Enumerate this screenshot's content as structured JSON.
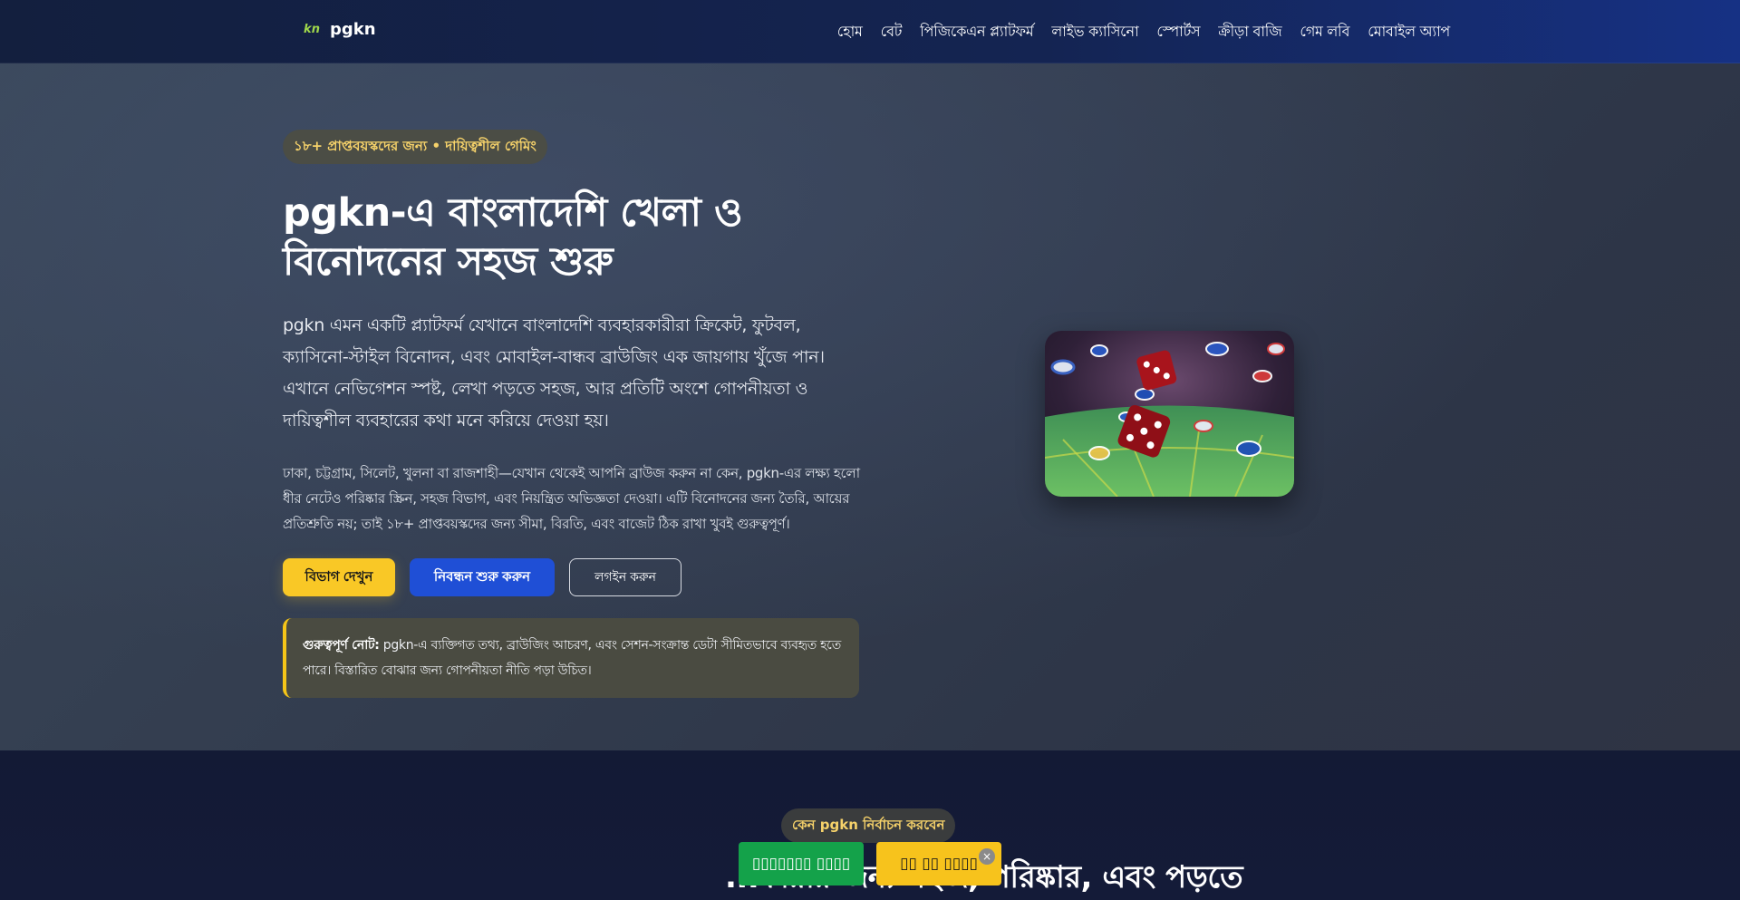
{
  "header": {
    "logo_mark": "kn",
    "brand": "pgkn",
    "nav": [
      {
        "label": "হোম"
      },
      {
        "label": "বেট"
      },
      {
        "label": "পিজিকেএন প্ল্যাটফর্ম"
      },
      {
        "label": "লাইভ ক্যাসিনো"
      },
      {
        "label": "স্পোর্টস"
      },
      {
        "label": "ক্রীড়া বাজি"
      },
      {
        "label": "গেম লবি"
      },
      {
        "label": "মোবাইল অ্যাপ"
      }
    ]
  },
  "hero": {
    "badge": "১৮+ প্রাপ্তবয়স্কদের জন্য • দায়িত্বশীল গেমিং",
    "title": "pgkn-এ বাংলাদেশি খেলা ও বিনোদনের সহজ শুরু",
    "lead": "pgkn এমন একটি প্ল্যাটফর্ম যেখানে বাংলাদেশি ব্যবহারকারীরা ক্রিকেট, ফুটবল, ক্যাসিনো-স্টাইল বিনোদন, এবং মোবাইল-বান্ধব ব্রাউজিং এক জায়গায় খুঁজে পান। এখানে নেভিগেশন স্পষ্ট, লেখা পড়তে সহজ, আর প্রতিটি অংশে গোপনীয়তা ও দায়িত্বশীল ব্যবহারের কথা মনে করিয়ে দেওয়া হয়।",
    "body": "ঢাকা, চট্টগ্রাম, সিলেট, খুলনা বা রাজশাহী—যেখান থেকেই আপনি ব্রাউজ করুন না কেন, pgkn-এর লক্ষ্য হলো ধীর নেটেও পরিষ্কার স্ক্রিন, সহজ বিভাগ, এবং নিয়ন্ত্রিত অভিজ্ঞতা দেওয়া। এটি বিনোদনের জন্য তৈরি, আয়ের প্রতিশ্রুতি নয়; তাই ১৮+ প্রাপ্তবয়স্কদের জন্য সীমা, বিরতি, এবং বাজেট ঠিক রাখা খুবই গুরুত্বপূর্ণ।",
    "buttons": {
      "sections": "বিভাগ দেখুন",
      "register": "নিবন্ধন শুরু করুন",
      "login": "লগইন করুন"
    },
    "note": {
      "label": "গুরুত্বপূর্ণ নোট:",
      "text": "pgkn-এ ব্যক্তিগত তথ্য, ব্রাউজিং আচরণ, এবং সেশন-সংক্রান্ত ডেটা সীমিতভাবে ব্যবহৃত হতে পারে। বিস্তারিত বোঝার জন্য গোপনীয়তা নীতি পড়া উচিত।"
    },
    "image_icon": "casino-dice-chips-image"
  },
  "section2": {
    "badge": "কেন pgkn নির্বাচন করবেন",
    "title_visible": "...কারীর জন্য সহজ, পরিষ্কার, এবং পড়তে"
  },
  "floating": {
    "green_label": "▯▯▯▯▯▯▯ ▯▯▯▯",
    "yellow_label": "▯▯ ▯▯ ▯▯▯▯",
    "close_glyph": "×"
  },
  "colors": {
    "accent_yellow": "#f9c826",
    "accent_blue": "#1f4fd6",
    "accent_green": "#14a24a",
    "badge_text": "#f6d26a"
  }
}
